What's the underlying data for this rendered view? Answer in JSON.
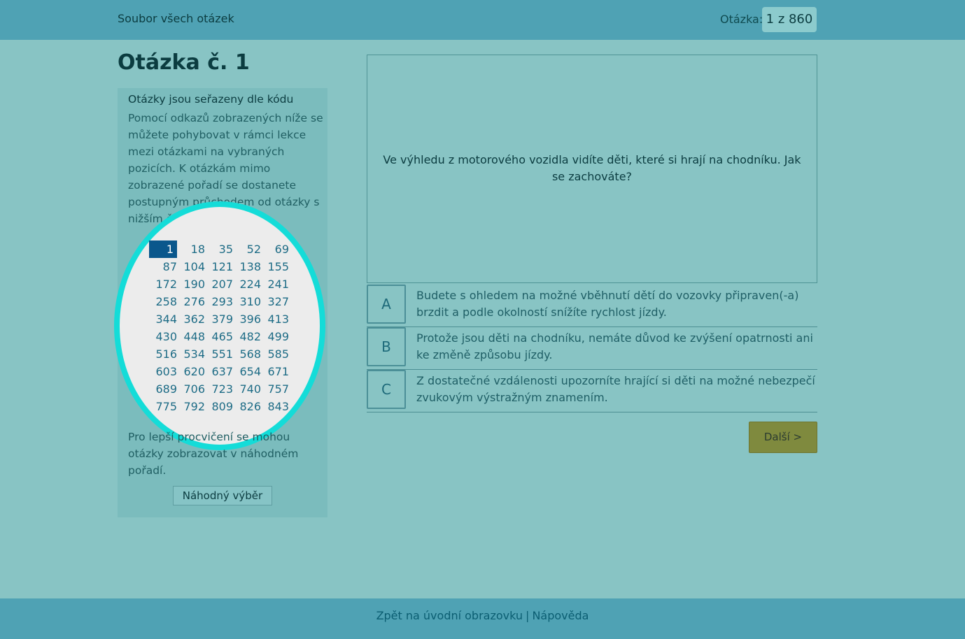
{
  "header": {
    "title": "Soubor všech otázek",
    "counter_label": "Otázka:",
    "counter_value": "1 z 860"
  },
  "page_title": "Otázka č. 1",
  "sidebar": {
    "heading": "Otázky jsou seřazeny dle kódu",
    "description": "Pomocí odkazů zobrazených níže se můžete pohybovat v rámci lekce mezi otázkami na vybraných pozicích. K otázkám mimo zobrazené pořadí se dostanete postupným průchodem od otázky s nižším číslem.",
    "numbers": [
      "1",
      "18",
      "35",
      "52",
      "69",
      "87",
      "104",
      "121",
      "138",
      "155",
      "172",
      "190",
      "207",
      "224",
      "241",
      "258",
      "276",
      "293",
      "310",
      "327",
      "344",
      "362",
      "379",
      "396",
      "413",
      "430",
      "448",
      "465",
      "482",
      "499",
      "516",
      "534",
      "551",
      "568",
      "585",
      "603",
      "620",
      "637",
      "654",
      "671",
      "689",
      "706",
      "723",
      "740",
      "757",
      "775",
      "792",
      "809",
      "826",
      "843"
    ],
    "active_number": "1",
    "footer_text": "Pro lepší procvičení se mohou otázky zobrazovat v náhodném pořadí.",
    "random_button": "Náhodný výběr"
  },
  "question": {
    "text": "Ve výhledu z motorového vozidla vidíte děti, které si hrají na chodníku. Jak se zachováte?"
  },
  "answers": [
    {
      "letter": "A",
      "text": "Budete s ohledem na možné vběhnutí dětí do vozovky připraven(-a) brzdit a podle okolností snížíte rychlost jízdy."
    },
    {
      "letter": "B",
      "text": "Protože jsou děti na chodníku, nemáte důvod ke zvýšení opatrnosti ani ke změně způsobu jízdy."
    },
    {
      "letter": "C",
      "text": "Z dostatečné vzdálenosti upozorníte hrající si děti na možné nebezpečí zvukovým výstražným znamením."
    }
  ],
  "next_button": "Další >",
  "footer": {
    "back_link": "Zpět na úvodní obrazovku",
    "separator": "|",
    "help_link": "Nápověda"
  },
  "colors": {
    "background": "#88c4c4",
    "bar": "#4fa2b4",
    "active_number": "#0a578c",
    "highlight_ellipse": "#14dcd8",
    "next_button": "#7f8a3e"
  }
}
